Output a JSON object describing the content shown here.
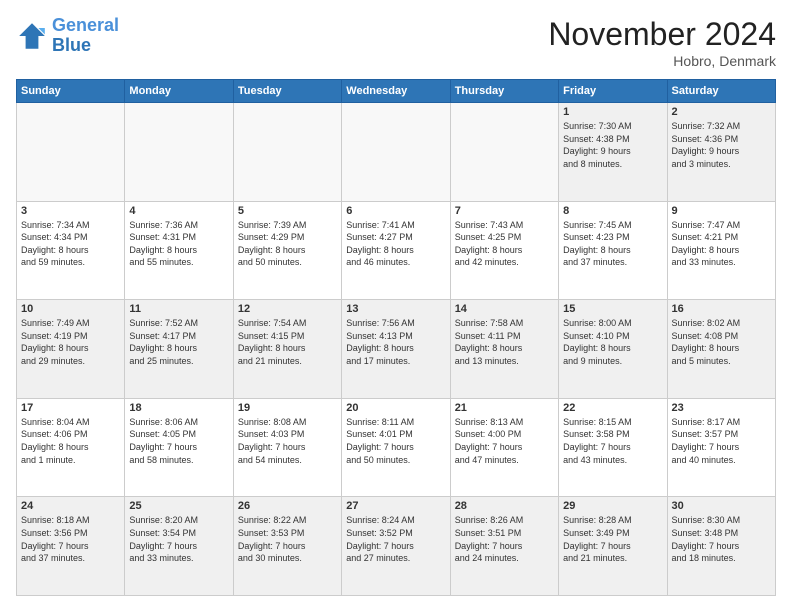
{
  "logo": {
    "line1": "General",
    "line2": "Blue"
  },
  "title": "November 2024",
  "location": "Hobro, Denmark",
  "days_header": [
    "Sunday",
    "Monday",
    "Tuesday",
    "Wednesday",
    "Thursday",
    "Friday",
    "Saturday"
  ],
  "weeks": [
    [
      {
        "day": "",
        "info": ""
      },
      {
        "day": "",
        "info": ""
      },
      {
        "day": "",
        "info": ""
      },
      {
        "day": "",
        "info": ""
      },
      {
        "day": "",
        "info": ""
      },
      {
        "day": "1",
        "info": "Sunrise: 7:30 AM\nSunset: 4:38 PM\nDaylight: 9 hours\nand 8 minutes."
      },
      {
        "day": "2",
        "info": "Sunrise: 7:32 AM\nSunset: 4:36 PM\nDaylight: 9 hours\nand 3 minutes."
      }
    ],
    [
      {
        "day": "3",
        "info": "Sunrise: 7:34 AM\nSunset: 4:34 PM\nDaylight: 8 hours\nand 59 minutes."
      },
      {
        "day": "4",
        "info": "Sunrise: 7:36 AM\nSunset: 4:31 PM\nDaylight: 8 hours\nand 55 minutes."
      },
      {
        "day": "5",
        "info": "Sunrise: 7:39 AM\nSunset: 4:29 PM\nDaylight: 8 hours\nand 50 minutes."
      },
      {
        "day": "6",
        "info": "Sunrise: 7:41 AM\nSunset: 4:27 PM\nDaylight: 8 hours\nand 46 minutes."
      },
      {
        "day": "7",
        "info": "Sunrise: 7:43 AM\nSunset: 4:25 PM\nDaylight: 8 hours\nand 42 minutes."
      },
      {
        "day": "8",
        "info": "Sunrise: 7:45 AM\nSunset: 4:23 PM\nDaylight: 8 hours\nand 37 minutes."
      },
      {
        "day": "9",
        "info": "Sunrise: 7:47 AM\nSunset: 4:21 PM\nDaylight: 8 hours\nand 33 minutes."
      }
    ],
    [
      {
        "day": "10",
        "info": "Sunrise: 7:49 AM\nSunset: 4:19 PM\nDaylight: 8 hours\nand 29 minutes."
      },
      {
        "day": "11",
        "info": "Sunrise: 7:52 AM\nSunset: 4:17 PM\nDaylight: 8 hours\nand 25 minutes."
      },
      {
        "day": "12",
        "info": "Sunrise: 7:54 AM\nSunset: 4:15 PM\nDaylight: 8 hours\nand 21 minutes."
      },
      {
        "day": "13",
        "info": "Sunrise: 7:56 AM\nSunset: 4:13 PM\nDaylight: 8 hours\nand 17 minutes."
      },
      {
        "day": "14",
        "info": "Sunrise: 7:58 AM\nSunset: 4:11 PM\nDaylight: 8 hours\nand 13 minutes."
      },
      {
        "day": "15",
        "info": "Sunrise: 8:00 AM\nSunset: 4:10 PM\nDaylight: 8 hours\nand 9 minutes."
      },
      {
        "day": "16",
        "info": "Sunrise: 8:02 AM\nSunset: 4:08 PM\nDaylight: 8 hours\nand 5 minutes."
      }
    ],
    [
      {
        "day": "17",
        "info": "Sunrise: 8:04 AM\nSunset: 4:06 PM\nDaylight: 8 hours\nand 1 minute."
      },
      {
        "day": "18",
        "info": "Sunrise: 8:06 AM\nSunset: 4:05 PM\nDaylight: 7 hours\nand 58 minutes."
      },
      {
        "day": "19",
        "info": "Sunrise: 8:08 AM\nSunset: 4:03 PM\nDaylight: 7 hours\nand 54 minutes."
      },
      {
        "day": "20",
        "info": "Sunrise: 8:11 AM\nSunset: 4:01 PM\nDaylight: 7 hours\nand 50 minutes."
      },
      {
        "day": "21",
        "info": "Sunrise: 8:13 AM\nSunset: 4:00 PM\nDaylight: 7 hours\nand 47 minutes."
      },
      {
        "day": "22",
        "info": "Sunrise: 8:15 AM\nSunset: 3:58 PM\nDaylight: 7 hours\nand 43 minutes."
      },
      {
        "day": "23",
        "info": "Sunrise: 8:17 AM\nSunset: 3:57 PM\nDaylight: 7 hours\nand 40 minutes."
      }
    ],
    [
      {
        "day": "24",
        "info": "Sunrise: 8:18 AM\nSunset: 3:56 PM\nDaylight: 7 hours\nand 37 minutes."
      },
      {
        "day": "25",
        "info": "Sunrise: 8:20 AM\nSunset: 3:54 PM\nDaylight: 7 hours\nand 33 minutes."
      },
      {
        "day": "26",
        "info": "Sunrise: 8:22 AM\nSunset: 3:53 PM\nDaylight: 7 hours\nand 30 minutes."
      },
      {
        "day": "27",
        "info": "Sunrise: 8:24 AM\nSunset: 3:52 PM\nDaylight: 7 hours\nand 27 minutes."
      },
      {
        "day": "28",
        "info": "Sunrise: 8:26 AM\nSunset: 3:51 PM\nDaylight: 7 hours\nand 24 minutes."
      },
      {
        "day": "29",
        "info": "Sunrise: 8:28 AM\nSunset: 3:49 PM\nDaylight: 7 hours\nand 21 minutes."
      },
      {
        "day": "30",
        "info": "Sunrise: 8:30 AM\nSunset: 3:48 PM\nDaylight: 7 hours\nand 18 minutes."
      }
    ]
  ]
}
